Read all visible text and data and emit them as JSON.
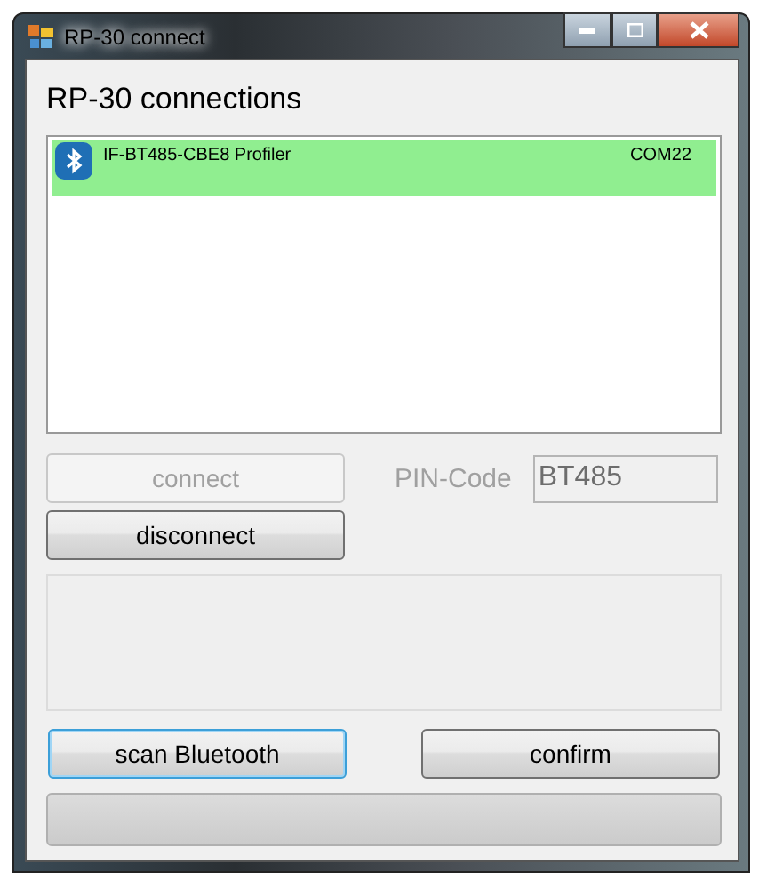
{
  "window": {
    "title": "RP-30 connect"
  },
  "heading": "RP-30 connections",
  "connections": [
    {
      "name": "IF-BT485-CBE8 Profiler",
      "port": "COM22",
      "selected": true
    }
  ],
  "connect_button": {
    "label": "connect",
    "disabled": true
  },
  "pin": {
    "label": "PIN-Code",
    "value": "BT485",
    "disabled": true
  },
  "disconnect_button": {
    "label": "disconnect",
    "disabled": false
  },
  "scan_button": {
    "label": "scan Bluetooth",
    "focused": true
  },
  "confirm_button": {
    "label": "confirm",
    "focused": false
  },
  "progress": {
    "level": 0
  }
}
